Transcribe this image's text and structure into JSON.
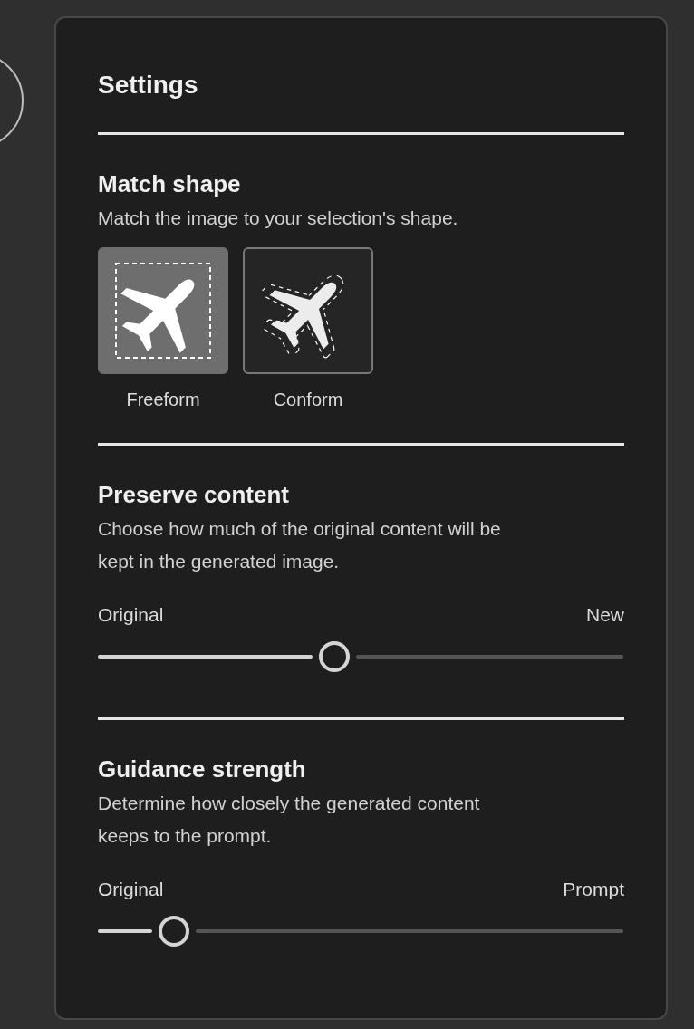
{
  "panel": {
    "title": "Settings"
  },
  "sections": [
    {
      "kind": "options",
      "title": "Match shape",
      "description": "Match the image to your selection's shape.",
      "options": [
        {
          "label": "Freeform",
          "kind": "freeform",
          "selected": true
        },
        {
          "label": "Conform",
          "kind": "conform",
          "selected": false
        }
      ]
    },
    {
      "kind": "slider",
      "title": "Preserve content",
      "description": "Choose how much of the original content will be kept in the generated image.",
      "min_label": "Original",
      "max_label": "New",
      "level": 0.45
    },
    {
      "kind": "slider",
      "title": "Guidance strength",
      "description": "Determine how closely the generated content keeps to the prompt.",
      "min_label": "Original",
      "max_label": "Prompt",
      "level": 0.145
    }
  ]
}
